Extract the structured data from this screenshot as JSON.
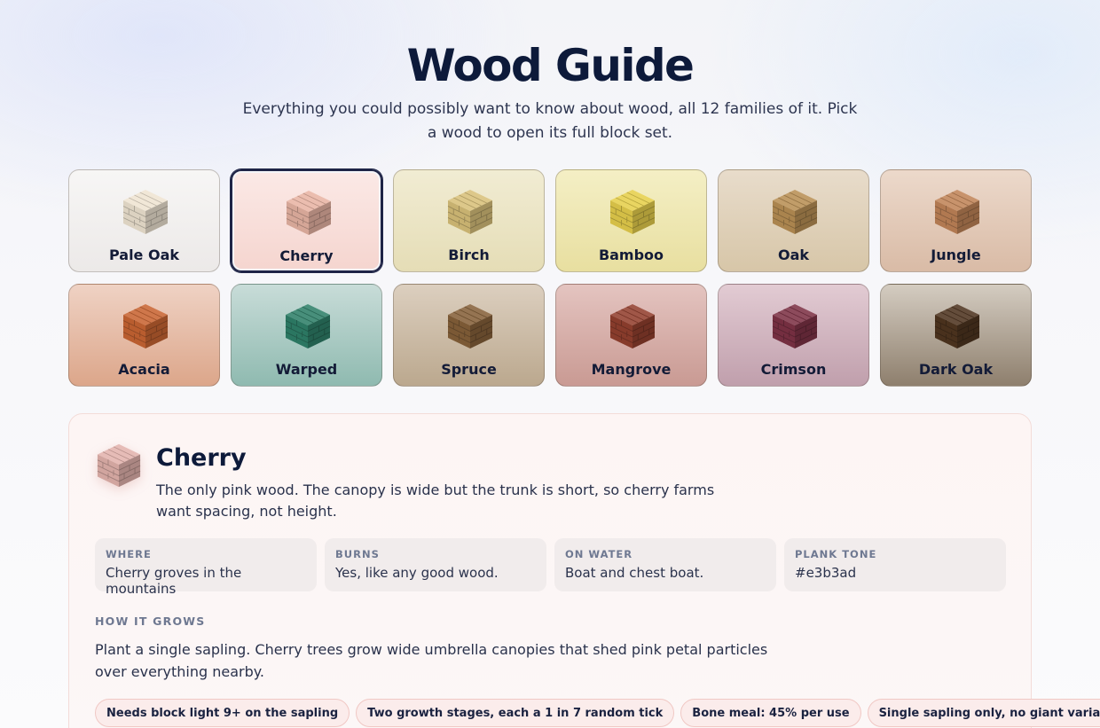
{
  "header": {
    "title": "Wood Guide",
    "subtitle": "Everything you could possibly want to know about wood, all 12 families of it. Pick a wood to open its full block set."
  },
  "woods": [
    {
      "label": "Pale Oak",
      "icon": "pale-oak-planks-icon",
      "plank": "#efe4d2",
      "bg_top": "#f7f6f5",
      "bg_bottom": "#ece9e8",
      "selected": false
    },
    {
      "label": "Cherry",
      "icon": "cherry-planks-icon",
      "plank": "#e8b4a4",
      "bg_top": "#fbe9e6",
      "bg_bottom": "#f5d5cf",
      "selected": true
    },
    {
      "label": "Birch",
      "icon": "birch-planks-icon",
      "plank": "#d8c07a",
      "bg_top": "#f1ecd3",
      "bg_bottom": "#e5ddb6",
      "selected": false
    },
    {
      "label": "Bamboo",
      "icon": "bamboo-planks-icon",
      "plank": "#e6cf4c",
      "bg_top": "#f4efc5",
      "bg_bottom": "#e8dfa0",
      "selected": false
    },
    {
      "label": "Oak",
      "icon": "oak-planks-icon",
      "plank": "#b99055",
      "bg_top": "#e8dccb",
      "bg_bottom": "#d7c6a8",
      "selected": false
    },
    {
      "label": "Jungle",
      "icon": "jungle-planks-icon",
      "plank": "#c08458",
      "bg_top": "#ecd9cb",
      "bg_bottom": "#d9bba6",
      "selected": false
    },
    {
      "label": "Acacia",
      "icon": "acacia-planks-icon",
      "plank": "#c96533",
      "bg_top": "#efd2c4",
      "bg_bottom": "#dca68a",
      "selected": false
    },
    {
      "label": "Warped",
      "icon": "warped-planks-icon",
      "plank": "#2f8069",
      "bg_top": "#c8dcd8",
      "bg_bottom": "#8fbab0",
      "selected": false
    },
    {
      "label": "Spruce",
      "icon": "spruce-planks-icon",
      "plank": "#86613a",
      "bg_top": "#dccfbf",
      "bg_bottom": "#bba88e",
      "selected": false
    },
    {
      "label": "Mangrove",
      "icon": "mangrove-planks-icon",
      "plank": "#93402f",
      "bg_top": "#e4c4c0",
      "bg_bottom": "#c99a93",
      "selected": false
    },
    {
      "label": "Crimson",
      "icon": "crimson-planks-icon",
      "plank": "#7e3246",
      "bg_top": "#e2cbd3",
      "bg_bottom": "#c09fac",
      "selected": false
    },
    {
      "label": "Dark Oak",
      "icon": "dark-oak-planks-icon",
      "plank": "#4f3520",
      "bg_top": "#d4ccc1",
      "bg_bottom": "#8e7f6d",
      "selected": false
    }
  ],
  "detail": {
    "title": "Cherry",
    "icon": "cherry-planks-icon",
    "plank": "#e3b3ad",
    "description": "The only pink wood. The canopy is wide but the trunk is short, so cherry farms want spacing, not height.",
    "facts": [
      {
        "label": "WHERE",
        "value": "Cherry groves in the mountains"
      },
      {
        "label": "BURNS",
        "value": "Yes, like any good wood."
      },
      {
        "label": "ON WATER",
        "value": "Boat and chest boat."
      },
      {
        "label": "PLANK TONE",
        "value": "#e3b3ad"
      }
    ],
    "growth_label": "HOW IT GROWS",
    "growth_text": "Plant a single sapling. Cherry trees grow wide umbrella canopies that shed pink petal particles over everything nearby.",
    "chips": [
      "Needs block light 9+ on the sapling",
      "Two growth stages, each a 1 in 7 random tick",
      "Bone meal: 45% per use",
      "Single sapling only, no giant variant"
    ]
  }
}
